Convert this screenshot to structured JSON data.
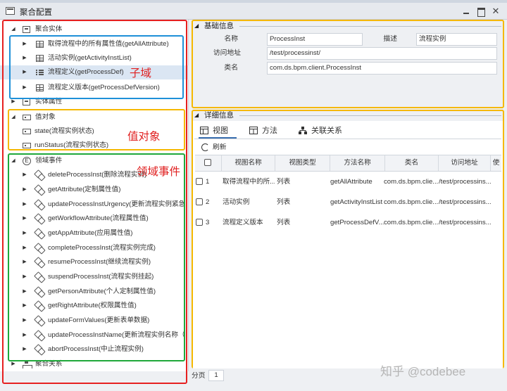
{
  "window": {
    "title": "聚合配置"
  },
  "tree": {
    "aggregate_entity": "聚合实体",
    "sub_items": [
      "取得流程中的所有属性值(getAllAttribute)",
      "活动实例(getActivityInstList)",
      "流程定义(getProcessDef)",
      "流程定义版本(getProcessDefVersion)"
    ],
    "entity_attrs": "实体属性",
    "value_object": "值对象",
    "value_items": [
      "state(流程实例状态)",
      "runStatus(流程实例状态)"
    ],
    "domain_events": "领域事件",
    "event_items": [
      "deleteProcessInst(删除流程实例)",
      "getAttribute(定制属性值)",
      "updateProcessInstUrgency(更新流程实例紧急",
      "getWorkflowAttribute(流程属性值)",
      "getAppAttribute(应用属性值)",
      "completeProcessInst(流程实例完成)",
      "resumeProcessInst(继续流程实例)",
      "suspendProcessInst(流程实例挂起)",
      "getPersonAttribute(个人定制属性值)",
      "getRightAttribute(权限属性值)",
      "updateFormValues(更新表单数据)",
      "updateProcessInstName(更新流程实例名称（",
      "abortProcessInst(中止流程实例)"
    ],
    "aggregate_relation": "聚合关系"
  },
  "annotations": {
    "subdomain": "子域",
    "value_object": "值对象",
    "domain_event": "领域事件"
  },
  "basic_info": {
    "heading": "基础信息",
    "name_label": "名称",
    "name_value": "ProcessInst",
    "desc_label": "描述",
    "desc_value": "流程实例",
    "url_label": "访问地址",
    "url_value": "/test/processinst/",
    "class_label": "类名",
    "class_value": "com.ds.bpm.client.ProcessInst"
  },
  "detail_info": {
    "heading": "详细信息",
    "tabs": [
      "视图",
      "方法",
      "关联关系"
    ],
    "refresh_label": "刷新",
    "columns": [
      "视图名称",
      "视图类型",
      "方法名称",
      "类名",
      "访问地址",
      "使"
    ],
    "rows": [
      {
        "index": "1",
        "view_name": "取得流程中的所...",
        "view_type": "列表",
        "method": "getAllAttribute",
        "class": "com.ds.bpm.clie...",
        "url": "/test/processins..."
      },
      {
        "index": "2",
        "view_name": "活动实例",
        "view_type": "列表",
        "method": "getActivityInstList",
        "class": "com.ds.bpm.clie...",
        "url": "/test/processins..."
      },
      {
        "index": "3",
        "view_name": "流程定义版本",
        "view_type": "列表",
        "method": "getProcessDefV...",
        "class": "com.ds.bpm.clie...",
        "url": "/test/processins..."
      }
    ]
  },
  "pager": {
    "label": "分页",
    "page": "1"
  },
  "watermark": "知乎 @codebee",
  "colors": {
    "red_box": "#e62020",
    "blue_box": "#1e90d8",
    "yellow_box": "#f5b800",
    "green_box": "#1fa83a",
    "selected_row": "#dbe6f3"
  }
}
